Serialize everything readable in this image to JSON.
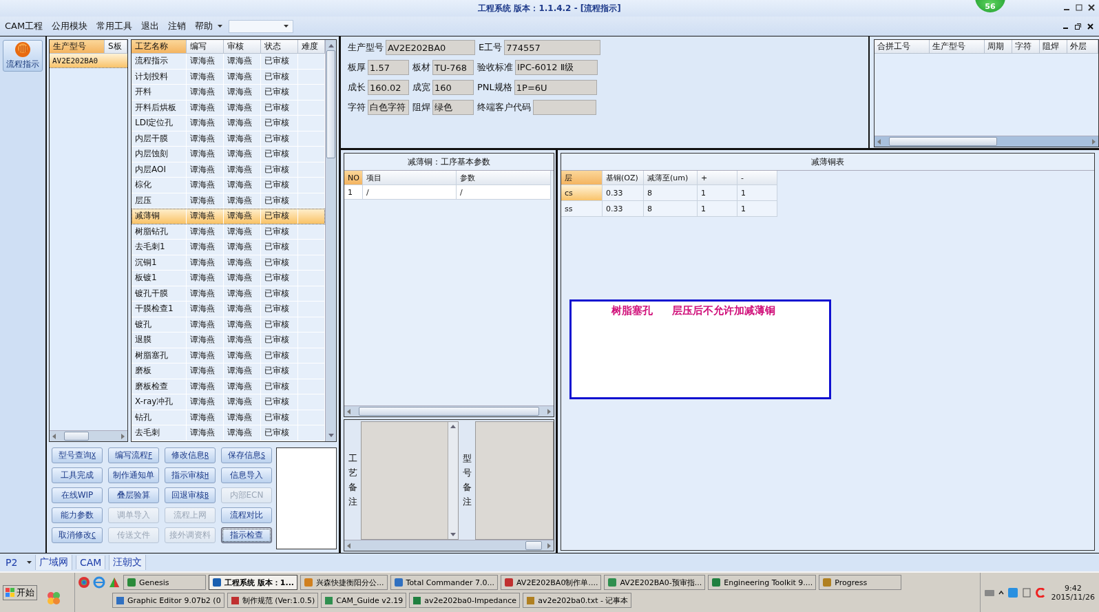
{
  "window": {
    "title": "工程系统  版本：1.1.4.2 - [流程指示]",
    "badge": "56"
  },
  "menu": {
    "items": [
      "CAM工程",
      "公用模块",
      "常用工具",
      "退出",
      "注销",
      "帮助"
    ]
  },
  "side_button": {
    "label": "流程指示"
  },
  "models": {
    "columns": [
      "生产型号",
      "S板"
    ],
    "rows": [
      {
        "model": "AV2E202BA0",
        "selected": true
      }
    ]
  },
  "processes": {
    "columns": [
      "工艺名称",
      "编写",
      "审核",
      "状态",
      "难度"
    ],
    "rows": [
      {
        "name": "流程指示",
        "writer": "谭海燕",
        "reviewer": "谭海燕",
        "status": "已审核",
        "selected": false
      },
      {
        "name": "计划投料",
        "writer": "谭海燕",
        "reviewer": "谭海燕",
        "status": "已审核",
        "selected": false
      },
      {
        "name": "开料",
        "writer": "谭海燕",
        "reviewer": "谭海燕",
        "status": "已审核",
        "selected": false
      },
      {
        "name": "开料后烘板",
        "writer": "谭海燕",
        "reviewer": "谭海燕",
        "status": "已审核",
        "selected": false
      },
      {
        "name": "LDI定位孔",
        "writer": "谭海燕",
        "reviewer": "谭海燕",
        "status": "已审核",
        "selected": false
      },
      {
        "name": "内层干膜",
        "writer": "谭海燕",
        "reviewer": "谭海燕",
        "status": "已审核",
        "selected": false
      },
      {
        "name": "内层蚀刻",
        "writer": "谭海燕",
        "reviewer": "谭海燕",
        "status": "已审核",
        "selected": false
      },
      {
        "name": "内层AOI",
        "writer": "谭海燕",
        "reviewer": "谭海燕",
        "status": "已审核",
        "selected": false
      },
      {
        "name": "棕化",
        "writer": "谭海燕",
        "reviewer": "谭海燕",
        "status": "已审核",
        "selected": false
      },
      {
        "name": "层压",
        "writer": "谭海燕",
        "reviewer": "谭海燕",
        "status": "已审核",
        "selected": false
      },
      {
        "name": "减薄铜",
        "writer": "谭海燕",
        "reviewer": "谭海燕",
        "status": "已审核",
        "selected": true
      },
      {
        "name": "树脂钻孔",
        "writer": "谭海燕",
        "reviewer": "谭海燕",
        "status": "已审核",
        "selected": false
      },
      {
        "name": "去毛刺1",
        "writer": "谭海燕",
        "reviewer": "谭海燕",
        "status": "已审核",
        "selected": false
      },
      {
        "name": "沉铜1",
        "writer": "谭海燕",
        "reviewer": "谭海燕",
        "status": "已审核",
        "selected": false
      },
      {
        "name": "板镀1",
        "writer": "谭海燕",
        "reviewer": "谭海燕",
        "status": "已审核",
        "selected": false
      },
      {
        "name": "镀孔干膜",
        "writer": "谭海燕",
        "reviewer": "谭海燕",
        "status": "已审核",
        "selected": false
      },
      {
        "name": "干膜检查1",
        "writer": "谭海燕",
        "reviewer": "谭海燕",
        "status": "已审核",
        "selected": false
      },
      {
        "name": "镀孔",
        "writer": "谭海燕",
        "reviewer": "谭海燕",
        "status": "已审核",
        "selected": false
      },
      {
        "name": "退膜",
        "writer": "谭海燕",
        "reviewer": "谭海燕",
        "status": "已审核",
        "selected": false
      },
      {
        "name": "树脂塞孔",
        "writer": "谭海燕",
        "reviewer": "谭海燕",
        "status": "已审核",
        "selected": false
      },
      {
        "name": "磨板",
        "writer": "谭海燕",
        "reviewer": "谭海燕",
        "status": "已审核",
        "selected": false
      },
      {
        "name": "磨板检查",
        "writer": "谭海燕",
        "reviewer": "谭海燕",
        "status": "已审核",
        "selected": false
      },
      {
        "name": "X-ray冲孔",
        "writer": "谭海燕",
        "reviewer": "谭海燕",
        "status": "已审核",
        "selected": false
      },
      {
        "name": "钻孔",
        "writer": "谭海燕",
        "reviewer": "谭海燕",
        "status": "已审核",
        "selected": false
      },
      {
        "name": "去毛刺",
        "writer": "谭海燕",
        "reviewer": "谭海燕",
        "status": "已审核",
        "selected": false
      }
    ]
  },
  "buttons": [
    {
      "label": "型号查询",
      "shortcut": "X",
      "disabled": false,
      "focused": false
    },
    {
      "label": "编写流程",
      "shortcut": "F",
      "disabled": false,
      "focused": false
    },
    {
      "label": "修改信息",
      "shortcut": "R",
      "disabled": false,
      "focused": false
    },
    {
      "label": "保存信息",
      "shortcut": "S",
      "disabled": false,
      "focused": false
    },
    {
      "label": "工具完成",
      "disabled": false,
      "focused": false
    },
    {
      "label": "制作通知单",
      "disabled": false,
      "focused": false
    },
    {
      "label": "指示审核",
      "shortcut": "H",
      "disabled": false,
      "focused": false
    },
    {
      "label": "信息导入",
      "disabled": false,
      "focused": false
    },
    {
      "label": "在线WIP",
      "disabled": false,
      "focused": false
    },
    {
      "label": "叠层验算",
      "disabled": false,
      "focused": false
    },
    {
      "label": "回退审核",
      "shortcut": "B",
      "disabled": false,
      "focused": false
    },
    {
      "label": "内部ECN",
      "disabled": true,
      "focused": false
    },
    {
      "label": "能力参数",
      "disabled": false,
      "focused": false
    },
    {
      "label": "调单导入",
      "disabled": true,
      "focused": false
    },
    {
      "label": "流程上网",
      "disabled": true,
      "focused": false
    },
    {
      "label": "流程对比",
      "disabled": false,
      "focused": false
    },
    {
      "label": "取消修改",
      "shortcut": "C",
      "disabled": false,
      "focused": false
    },
    {
      "label": "传送文件",
      "disabled": true,
      "focused": false
    },
    {
      "label": "接外调资料",
      "disabled": true,
      "focused": false
    },
    {
      "label": "指示检查",
      "disabled": false,
      "focused": true
    }
  ],
  "info": [
    [
      {
        "label": "生产型号",
        "value": "AV2E202BA0"
      },
      {
        "label": "E工号",
        "value": "774557"
      }
    ],
    [
      {
        "label": "板厚",
        "value": "1.57"
      },
      {
        "label": "板材",
        "value": "TU-768"
      },
      {
        "label": "验收标准",
        "value": "IPC-6012 Ⅱ级"
      }
    ],
    [
      {
        "label": "成长",
        "value": "160.02"
      },
      {
        "label": "成宽",
        "value": "160"
      },
      {
        "label": "PNL规格",
        "value": "1P=6U"
      }
    ],
    [
      {
        "label": "字符",
        "value": "白色字符"
      },
      {
        "label": "阻焊",
        "value": "绿色"
      },
      {
        "label": "终端客户代码"
      }
    ]
  ],
  "merge_table": {
    "columns": [
      "合拼工号",
      "生产型号",
      "周期",
      "字符",
      "阻焊",
      "外层"
    ]
  },
  "param_panel": {
    "title": "减薄铜：工序基本参数",
    "columns": [
      "NO",
      "项目",
      "参数"
    ],
    "rows": [
      [
        "1",
        "/",
        "/"
      ]
    ]
  },
  "thin_table": {
    "title": "减薄铜表",
    "columns": [
      "层",
      "基铜(OZ)",
      "减薄至(um)",
      "+",
      "-"
    ],
    "rows": [
      {
        "cells": [
          "cs",
          "0.33",
          "8",
          "1",
          "1"
        ],
        "selected": true
      },
      {
        "cells": [
          "ss",
          "0.33",
          "8",
          "1",
          "1"
        ],
        "selected": false
      }
    ]
  },
  "note": {
    "parts": [
      "树脂塞孔",
      "层压后不允许加减薄铜"
    ]
  },
  "remarks": [
    "工艺备注",
    "型号备注"
  ],
  "status_bar": {
    "page": "P2",
    "tabs": [
      "广域网",
      "CAM",
      "汪朝文"
    ]
  },
  "taskbar": {
    "start": "开始",
    "row1": [
      {
        "label": "Genesis",
        "active": false
      },
      {
        "label": "工程系统  版本：1...",
        "active": true
      },
      {
        "label": "兴森快捷衡阳分公...",
        "active": false
      },
      {
        "label": "Total Commander 7.0...",
        "active": false
      },
      {
        "label": "AV2E202BA0制作单....",
        "active": false
      },
      {
        "label": "AV2E202BA0-预审指...",
        "active": false
      },
      {
        "label": "Engineering Toolkit 9....",
        "active": false
      },
      {
        "label": "Progress",
        "active": false
      }
    ],
    "row2": [
      "Graphic Editor 9.07b2 (0",
      "制作规范 (Ver:1.0.5)",
      "CAM_Guide v2.19",
      "av2e202ba0-Impedance",
      "av2e202ba0.txt - 记事本"
    ],
    "time": "9:42",
    "date": "2015/11/26"
  }
}
